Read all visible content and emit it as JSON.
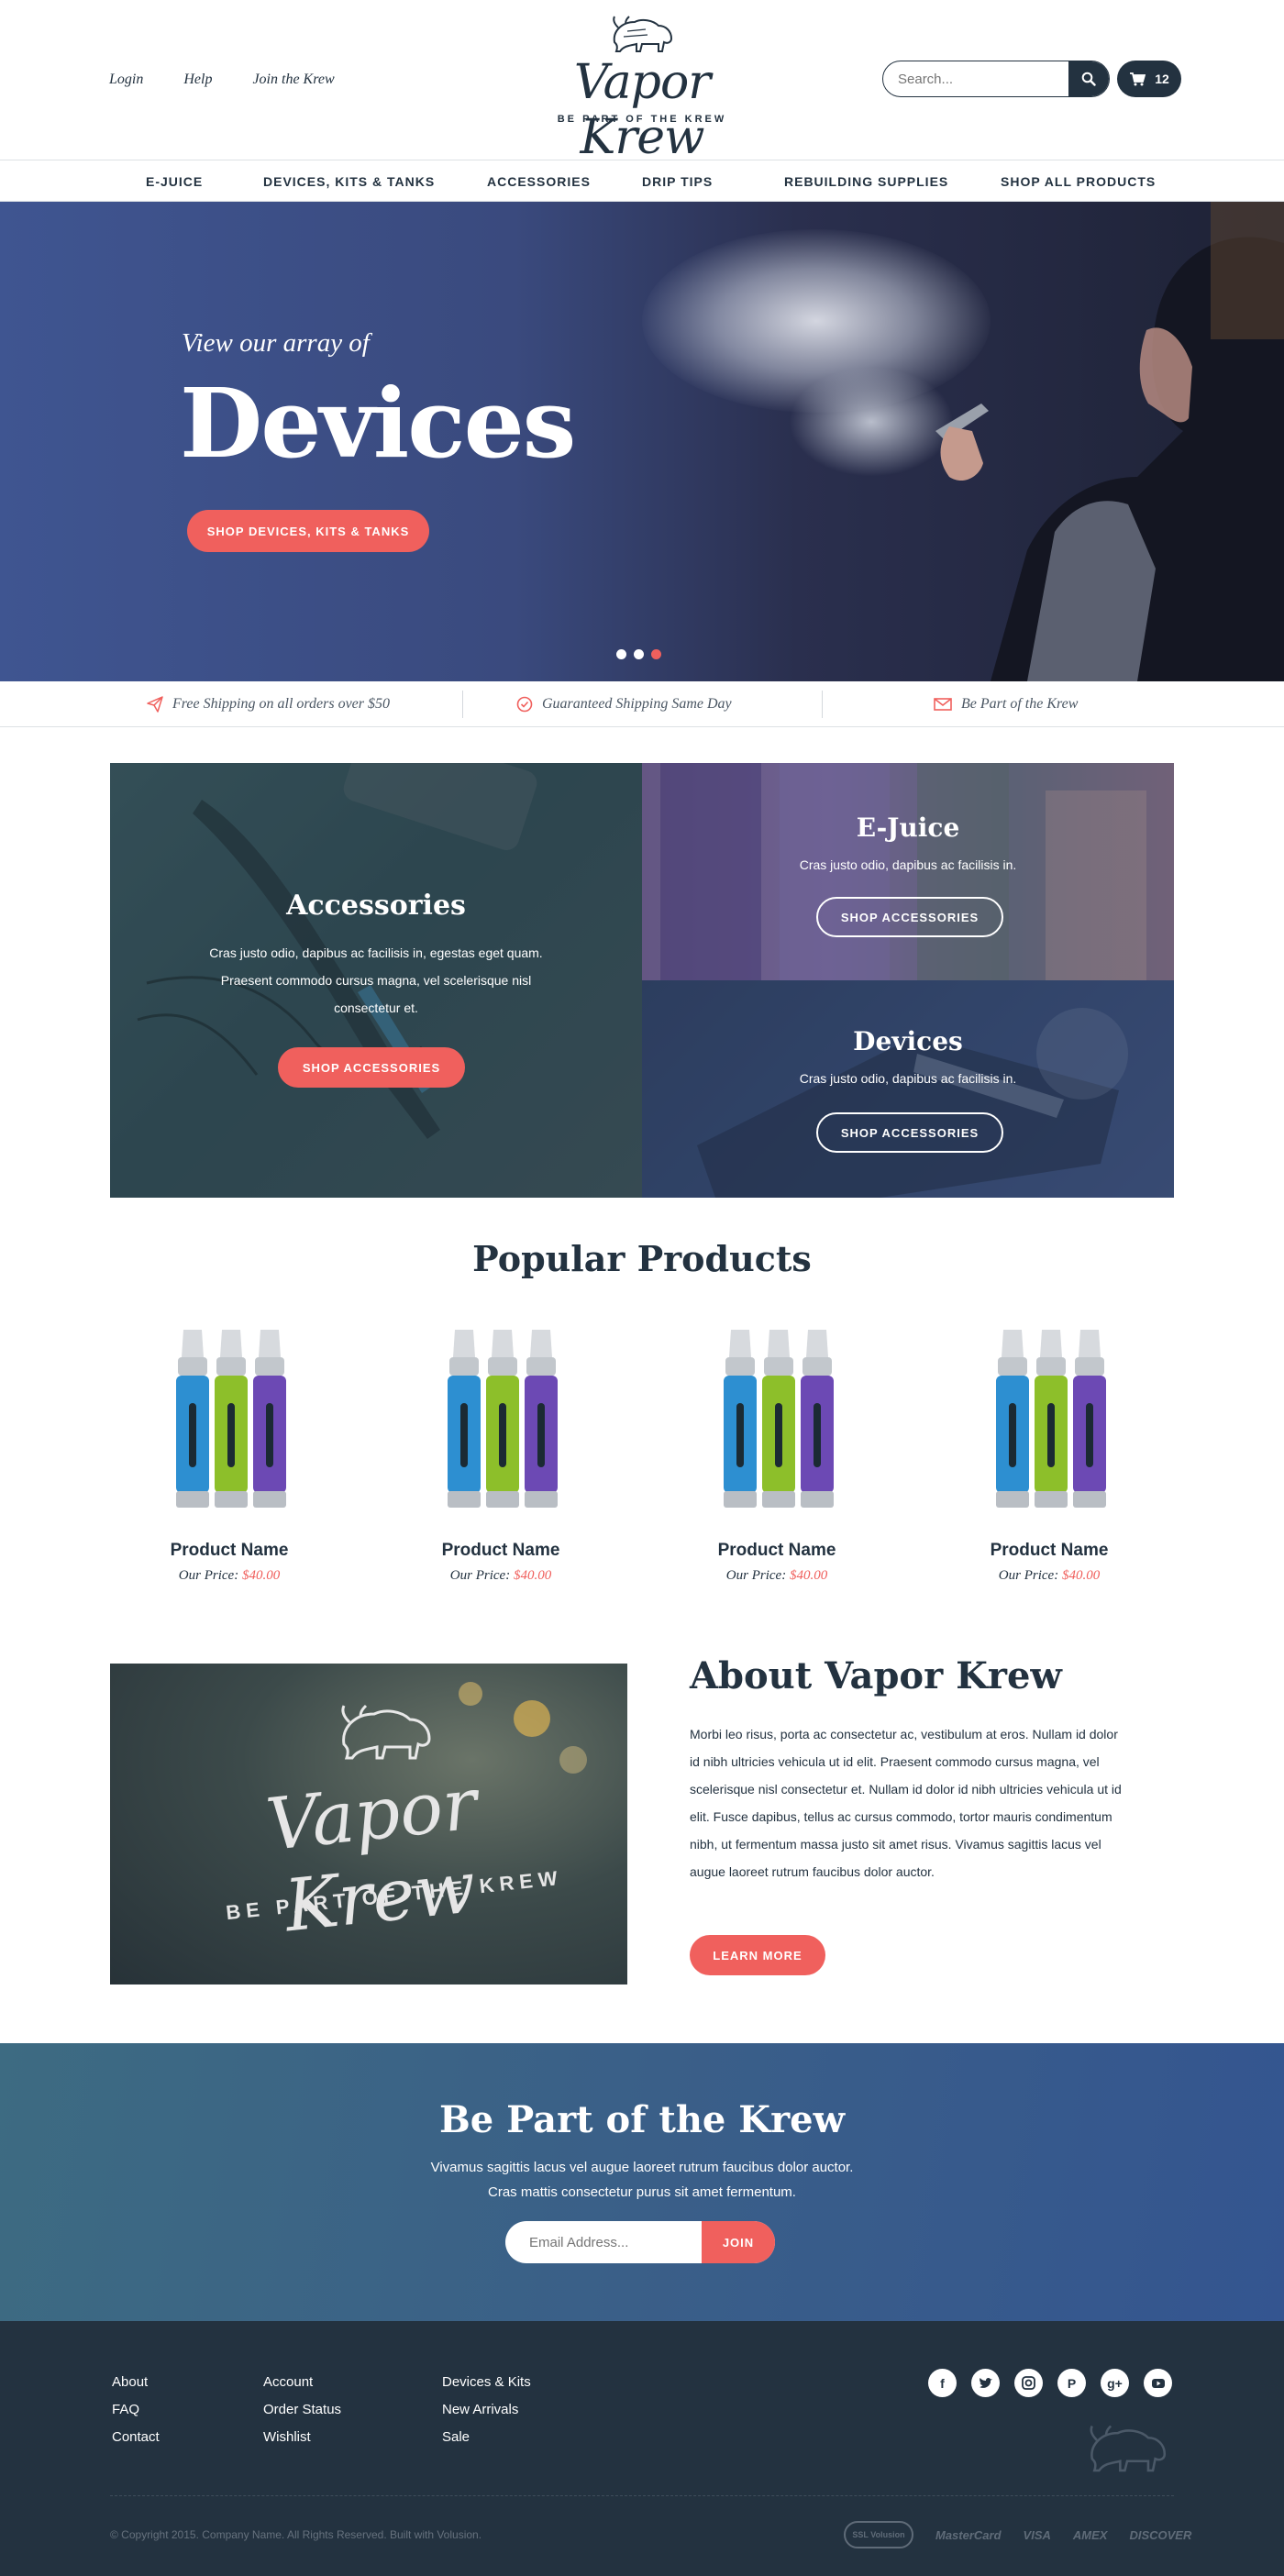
{
  "header": {
    "top_links": [
      "Login",
      "Help",
      "Join the Krew"
    ],
    "logo_text": "Vapor Krew",
    "logo_tagline": "BE PART OF THE KREW",
    "search_placeholder": "Search...",
    "cart_count": "12"
  },
  "nav": [
    "E-JUICE",
    "DEVICES, KITS & TANKS",
    "ACCESSORIES",
    "DRIP TIPS",
    "REBUILDING SUPPLIES",
    "SHOP ALL PRODUCTS"
  ],
  "hero": {
    "eyebrow": "View our array of",
    "title": "Devices",
    "cta": "SHOP DEVICES, KITS & TANKS",
    "slides": 3,
    "active_slide": 3
  },
  "perks": [
    "Free Shipping on all orders over $50",
    "Guaranteed Shipping Same Day",
    "Be Part of the Krew"
  ],
  "tiles": {
    "accessories": {
      "title": "Accessories",
      "text": "Cras justo odio, dapibus ac facilisis in, egestas eget quam. Praesent commodo cursus magna, vel scelerisque nisl consectetur et.",
      "button": "SHOP ACCESSORIES"
    },
    "ejuice": {
      "title": "E-Juice",
      "text": "Cras justo odio, dapibus ac facilisis in.",
      "button": "SHOP ACCESSORIES"
    },
    "devices": {
      "title": "Devices",
      "text": "Cras justo odio, dapibus ac facilisis in.",
      "button": "SHOP ACCESSORIES"
    }
  },
  "popular": {
    "title": "Popular Products",
    "products": [
      {
        "name": "Product Name",
        "price_label": "Our Price:",
        "price": "$40.00"
      },
      {
        "name": "Product Name",
        "price_label": "Our Price:",
        "price": "$40.00"
      },
      {
        "name": "Product Name",
        "price_label": "Our Price:",
        "price": "$40.00"
      },
      {
        "name": "Product Name",
        "price_label": "Our Price:",
        "price": "$40.00"
      }
    ]
  },
  "about": {
    "image_logo_text": "Vapor Krew",
    "image_logo_tagline": "BE PART OF THE KREW",
    "title": "About Vapor Krew",
    "text": "Morbi leo risus, porta ac consectetur ac, vestibulum at eros. Nullam id dolor id nibh ultricies vehicula ut id elit. Praesent commodo cursus magna, vel scelerisque nisl consectetur et. Nullam id dolor id nibh ultricies vehicula ut id elit. Fusce dapibus, tellus ac cursus commodo, tortor mauris condimentum nibh, ut fermentum massa justo sit amet risus. Vivamus sagittis lacus vel augue laoreet rutrum faucibus dolor auctor.",
    "button": "LEARN MORE"
  },
  "newsletter": {
    "title": "Be Part of the Krew",
    "line1": "Vivamus sagittis lacus vel augue laoreet rutrum faucibus dolor auctor.",
    "line2": "Cras mattis consectetur purus sit amet fermentum.",
    "placeholder": "Email Address...",
    "button": "JOIN"
  },
  "footer": {
    "col1": [
      "About",
      "FAQ",
      "Contact"
    ],
    "col2": [
      "Account",
      "Order Status",
      "Wishlist"
    ],
    "col3": [
      "Devices & Kits",
      "New Arrivals",
      "Sale"
    ],
    "social": [
      "facebook-icon",
      "twitter-icon",
      "instagram-icon",
      "pinterest-icon",
      "google-plus-icon",
      "youtube-icon"
    ],
    "copyright": "© Copyright 2015. Company Name. All Rights Reserved. Built with Volusion.",
    "payments": [
      "SSL Volusion",
      "MasterCard",
      "VISA",
      "AMEX",
      "DISCOVER"
    ]
  },
  "colors": {
    "navy": "#233240",
    "accent": "#f0605d",
    "newsletter_blue": "#3a5f88"
  }
}
